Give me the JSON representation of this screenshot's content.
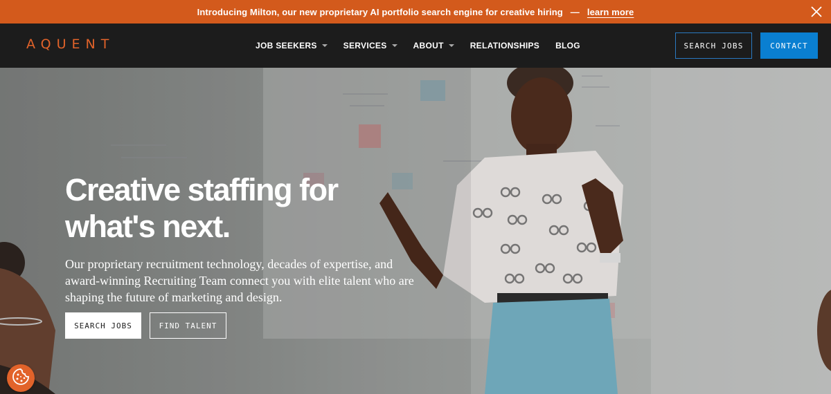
{
  "announcement": {
    "text": "Introducing Milton, our new proprietary AI portfolio search engine for creative hiring",
    "separator": "—",
    "link": "learn more",
    "close_icon": "close-icon"
  },
  "nav": {
    "logo": "AQUENT",
    "items": [
      {
        "label": "JOB SEEKERS",
        "dropdown": true
      },
      {
        "label": "SERVICES",
        "dropdown": true
      },
      {
        "label": "ABOUT",
        "dropdown": true
      },
      {
        "label": "RELATIONSHIPS",
        "dropdown": false
      },
      {
        "label": "BLOG",
        "dropdown": false
      }
    ],
    "search_jobs": "SEARCH JOBS",
    "contact": "CONTACT"
  },
  "hero": {
    "title_line1": "Creative staffing for",
    "title_line2": "what's next.",
    "subtitle": "Our proprietary recruitment technology, decades of expertise, and award-winning Recruiting Team connect you with elite talent who are shaping the future of marketing and design.",
    "search_jobs": "SEARCH JOBS",
    "find_talent": "FIND TALENT",
    "image": "woman-presenting-at-whiteboard"
  },
  "cookie_icon": "cookie-icon",
  "colors": {
    "accent_orange": "#d35a1c",
    "nav_bg": "#1c1c1c",
    "contact_blue": "#0a7fd1",
    "search_border": "#2a7ac3"
  }
}
